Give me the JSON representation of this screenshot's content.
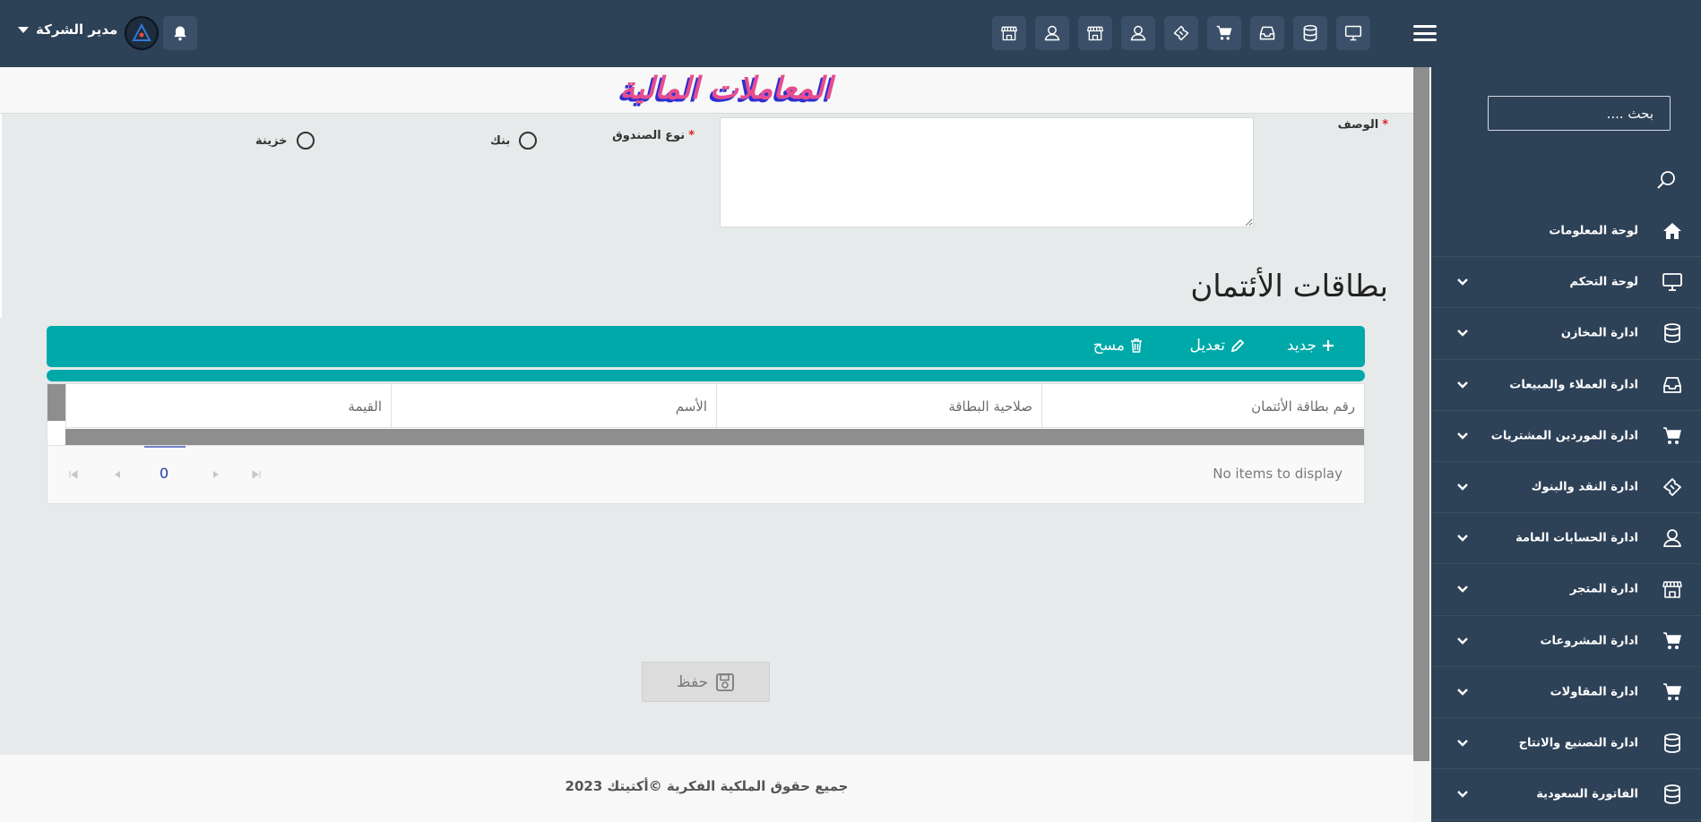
{
  "header": {
    "user_name": "مدير الشركة",
    "quick_icons": [
      "store-icon",
      "user-icon",
      "store-icon",
      "user-icon",
      "ticket-icon",
      "cart-icon",
      "inbox-icon",
      "database-icon",
      "monitor-icon"
    ]
  },
  "page": {
    "title": "المعاملات المالية"
  },
  "form": {
    "description_label": "الوصف",
    "box_type_label": "نوع الصندوق",
    "required_mark": "*",
    "options": [
      "بنك",
      "خزينة"
    ]
  },
  "credit_cards": {
    "title": "بطاقات الأئتمان",
    "toolbar": {
      "new_label": "جديد",
      "edit_label": "تعديل",
      "delete_label": "مسح"
    },
    "columns": [
      "رقم بطاقة الأئتمان",
      "صلاحية البطاقة",
      "الأسم",
      "القيمة"
    ],
    "empty_text": "No items to display",
    "page_number": "0"
  },
  "save_label": "حفظ",
  "sidebar": {
    "search_placeholder": "بحث ....",
    "items": [
      {
        "label": "لوحة المعلومات",
        "icon": "home-icon",
        "expandable": false
      },
      {
        "label": "لوحة التحكم",
        "icon": "monitor-icon",
        "expandable": true
      },
      {
        "label": "ادارة المخازن",
        "icon": "database-icon",
        "expandable": true
      },
      {
        "label": "ادارة العملاء والمبيعات",
        "icon": "inbox-icon",
        "expandable": true
      },
      {
        "label": "ادارة الموردين المشتريات",
        "icon": "cart-icon",
        "expandable": true
      },
      {
        "label": "ادارة النقد والبنوك",
        "icon": "ticket-icon",
        "expandable": true
      },
      {
        "label": "ادارة الحسابات العامة",
        "icon": "user-icon",
        "expandable": true
      },
      {
        "label": "ادارة المتجر",
        "icon": "store-icon",
        "expandable": true
      },
      {
        "label": "ادارة المشروعات",
        "icon": "cart-icon",
        "expandable": true
      },
      {
        "label": "ادارة المقاولات",
        "icon": "cart-icon",
        "expandable": true
      },
      {
        "label": "ادارة التصنيع والانتاج",
        "icon": "database-icon",
        "expandable": true
      },
      {
        "label": "الفاتورة السعودية",
        "icon": "database-icon",
        "expandable": true
      }
    ]
  },
  "footer": {
    "copyright": "جميع حقوق الملكية الفكرية ©أكتيتك 2023"
  },
  "colors": {
    "navy": "#2d4157",
    "teal": "#00a9a9",
    "title_pink": "#e74c8f",
    "title_shadow": "#2d2fd1"
  }
}
